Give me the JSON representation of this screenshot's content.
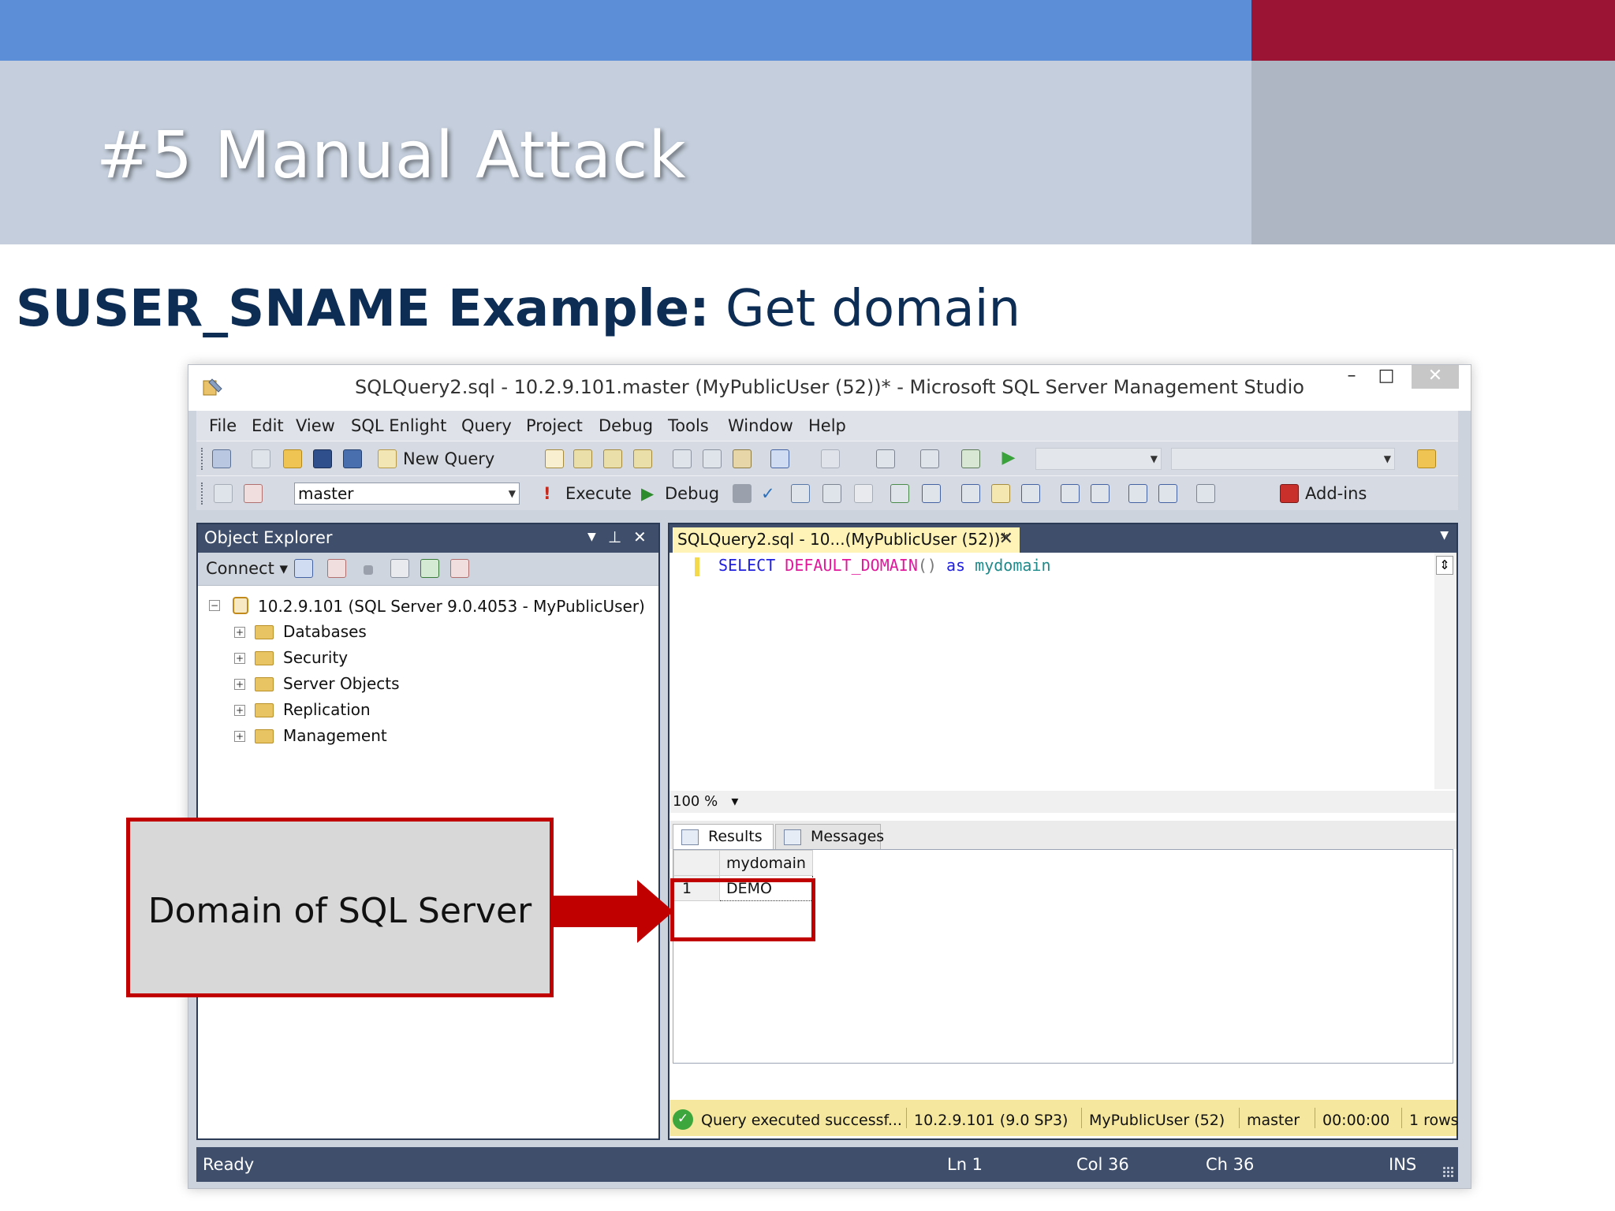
{
  "slide": {
    "title": "#5 Manual Attack",
    "subtitle_bold": "SUSER_SNAME Example:",
    "subtitle_rest": " Get domain",
    "colors": {
      "top_bar": "#5b8ed6",
      "accent": "#9b1434",
      "title_band": "#c4cedc",
      "subtitle": "#0d2d55",
      "callout_border": "#c00000"
    }
  },
  "window": {
    "title": "SQLQuery2.sql - 10.2.9.101.master (MyPublicUser (52))* - Microsoft SQL Server Management Studio",
    "buttons": {
      "minimize": "–",
      "maximize": "□",
      "close": "✕"
    }
  },
  "menu": [
    "File",
    "Edit",
    "View",
    "SQL Enlight",
    "Query",
    "Project",
    "Debug",
    "Tools",
    "Window",
    "Help"
  ],
  "toolbar1": {
    "new_query": "New Query"
  },
  "toolbar2": {
    "database": "master",
    "execute": "Execute",
    "debug": "Debug",
    "addins": "Add-ins"
  },
  "object_explorer": {
    "title": "Object Explorer",
    "connect": "Connect",
    "server": "10.2.9.101 (SQL Server 9.0.4053 - MyPublicUser)",
    "nodes": [
      "Databases",
      "Security",
      "Server Objects",
      "Replication",
      "Management"
    ]
  },
  "editor": {
    "tab_title": "SQLQuery2.sql - 10...(MyPublicUser (52))*",
    "code": {
      "select": "SELECT",
      "func": "DEFAULT_DOMAIN",
      "parens": "()",
      "as": "as",
      "alias": "mydomain"
    },
    "zoom": "100 %"
  },
  "results": {
    "tabs": [
      "Results",
      "Messages"
    ],
    "column": "mydomain",
    "row_number": "1",
    "value": "DEMO"
  },
  "exec_status": {
    "message": "Query executed successf...",
    "server": "10.2.9.101 (9.0 SP3)",
    "user": "MyPublicUser (52)",
    "db": "master",
    "time": "00:00:00",
    "rows": "1 rows"
  },
  "statusbar": {
    "ready": "Ready",
    "ln": "Ln 1",
    "col": "Col 36",
    "ch": "Ch 36",
    "mode": "INS"
  },
  "callout": {
    "text": "Domain of SQL Server"
  }
}
